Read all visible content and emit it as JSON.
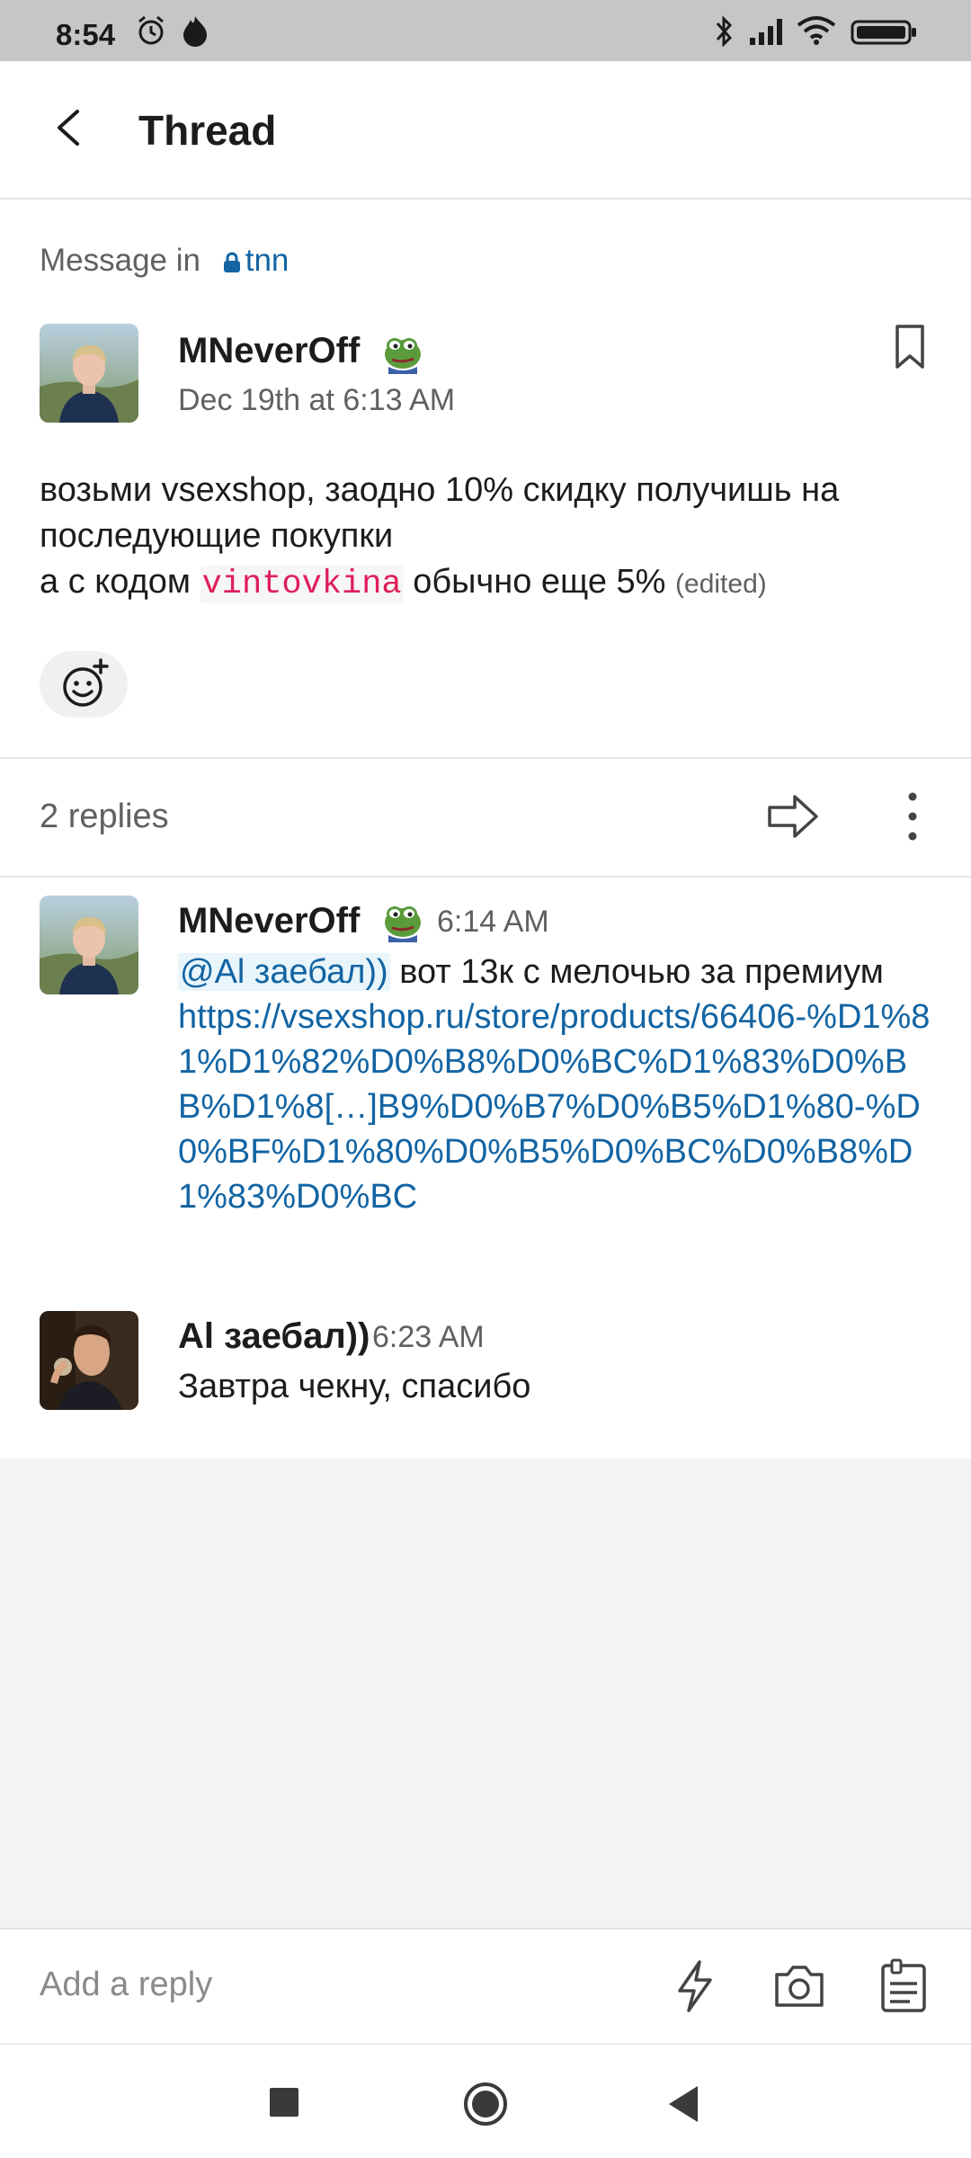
{
  "status_bar": {
    "time": "8:54"
  },
  "header": {
    "title": "Thread"
  },
  "context": {
    "prefix": "Message in",
    "channel": "tnn"
  },
  "parent_message": {
    "author": "MNeverOff",
    "timestamp": "Dec 19th at 6:13 AM",
    "line1": "возьми vsexshop, заодно 10% скидку получишь на последующие покупки",
    "line2_before": "а с кодом ",
    "code": "vintovkina",
    "line2_after": " обычно еще 5%",
    "edited": "(edited)"
  },
  "replies_header": {
    "count_text": "2 replies"
  },
  "replies": [
    {
      "author": "MNeverOff",
      "time": "6:14 AM",
      "mention": "@Al заебал))",
      "text": " вот 13к с мелочью за премиум",
      "link": "https://vsexshop.ru/store/products/66406-%D1%81%D1%82%D0%B8%D0%BC%D1%83%D0%BB%D1%8[…]B9%D0%B7%D0%B5%D1%80-%D0%BF%D1%80%D0%B5%D0%BC%D0%B8%D1%83%D0%BC"
    },
    {
      "author": "Al заебал))",
      "time": "6:23 AM",
      "text": "Завтра чекну, спасибо"
    }
  ],
  "composer": {
    "placeholder": "Add a reply"
  },
  "icons": {
    "back": "arrow-left-icon",
    "lock": "lock-icon",
    "emoji": "pepe-emoji-icon",
    "bookmark": "bookmark-icon",
    "add_reaction": "add-reaction-icon",
    "share": "share-icon",
    "more": "more-vertical-icon",
    "shortcuts": "lightning-icon",
    "camera": "camera-icon",
    "attach": "clipboard-icon"
  },
  "colors": {
    "link": "#1264a3",
    "code": "#e01e5a",
    "status_bar": "#c6c6c6"
  }
}
